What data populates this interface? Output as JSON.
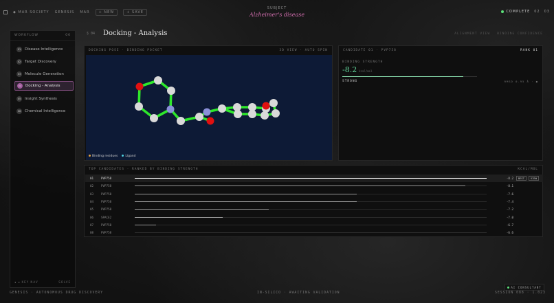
{
  "topbar": {
    "brand": "◆ MAR SOCIETY",
    "crumb_a": "GENESIS",
    "crumb_b": "MAR",
    "pill_a": "+ NEW",
    "pill_b": "+ SAVE",
    "subtitle": "SUBJECT",
    "disease": "Alzheimer's disease",
    "status": "COMPLETE",
    "right_a": "02",
    "right_b": "03"
  },
  "sidebar": {
    "heading": "WORKFLOW",
    "heading_right": "06",
    "items": [
      {
        "num": "01",
        "label": "Disease Intelligence"
      },
      {
        "num": "02",
        "label": "Target Discovery"
      },
      {
        "num": "03",
        "label": "Molecule Generation"
      },
      {
        "num": "04",
        "label": "Docking - Analysis"
      },
      {
        "num": "05",
        "label": "Insight Synthesis"
      },
      {
        "num": "06",
        "label": "Chemical Intelligence"
      }
    ],
    "footer_left": "◂ ◂ KEY NAV",
    "footer_right": "SOLVE"
  },
  "header": {
    "crumb": "§ 04",
    "title": "Docking - Analysis",
    "right_a": "ALIGNMENT VIEW",
    "right_b": "BINDING CONFIDENCE"
  },
  "docking": {
    "heading": "DOCKING POSE · BINDING POCKET",
    "heading_right": "3D VIEW · AUTO SPIN",
    "legend_residue": "Binding residues",
    "legend_ligand": "Ligand",
    "colors": {
      "bond": "#2ee82b",
      "carbon": "#d9d9d9",
      "oxygen": "#e01010",
      "nitrogen": "#8a8fd8",
      "background": "#0d1a36"
    }
  },
  "candidate": {
    "heading": "CANDIDATE 01 · PVP758",
    "rank": "RANK 01",
    "strength_label": "BINDING STRENGTH",
    "value": "-8.2",
    "unit": "kcal/mol",
    "strength_fraction": 0.9,
    "verdict": "STRONG",
    "verdict_right": "RMSD 0.95 Å · ●"
  },
  "table": {
    "heading": "TOP CANDIDATES · RANKED BY BINDING STRENGTH",
    "heading_right": "KCAL/MOL",
    "view_btn": "VIEW",
    "best_btn": "BEST",
    "rows": [
      {
        "rank": "01",
        "id": "PVP758",
        "score": "-8.2",
        "frac": 1.0
      },
      {
        "rank": "02",
        "id": "PVP758",
        "score": "-8.1",
        "frac": 0.94
      },
      {
        "rank": "03",
        "id": "PVP758",
        "score": "-7.6",
        "frac": 0.63
      },
      {
        "rank": "04",
        "id": "PVP758",
        "score": "-7.4",
        "frac": 0.63
      },
      {
        "rank": "05",
        "id": "PVP758",
        "score": "-7.2",
        "frac": 0.38
      },
      {
        "rank": "06",
        "id": "SPACE2",
        "score": "-7.0",
        "frac": 0.25
      },
      {
        "rank": "07",
        "id": "PVP758",
        "score": "-6.7",
        "frac": 0.06
      },
      {
        "rank": "08",
        "id": "PVP758",
        "score": "-6.6",
        "frac": 0.0
      }
    ]
  },
  "footer": {
    "left": "GENESIS · AUTONOMOUS DRUG DISCOVERY",
    "center": "IN-SILICO · AWAITING VALIDATION",
    "right": "SESSION 088 · 1.023",
    "consultant": "AI CONSULTANT"
  }
}
